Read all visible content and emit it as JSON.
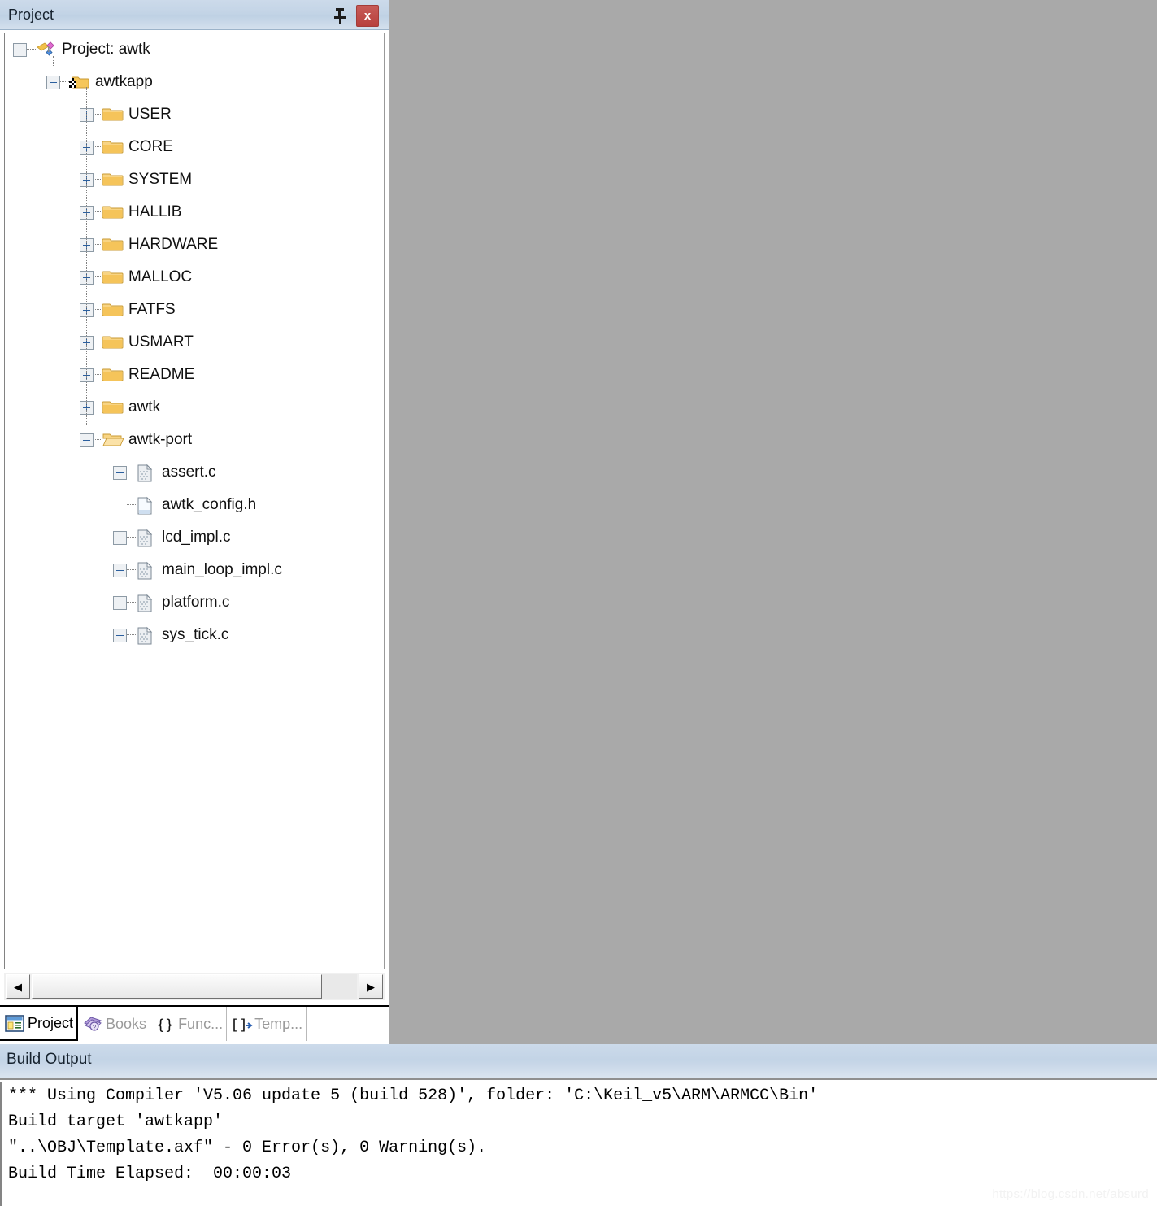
{
  "project_panel": {
    "title": "Project",
    "pin_icon": "pin-icon",
    "close_icon": "close-icon",
    "close_label": "x",
    "tree": [
      {
        "level": 0,
        "label": "Project: awtk",
        "icon": "project-icon",
        "expander": "minus"
      },
      {
        "level": 1,
        "label": "awtkapp",
        "icon": "target-folder-icon",
        "expander": "minus"
      },
      {
        "level": 2,
        "label": "USER",
        "icon": "folder-closed-icon",
        "expander": "plus"
      },
      {
        "level": 2,
        "label": "CORE",
        "icon": "folder-closed-icon",
        "expander": "plus"
      },
      {
        "level": 2,
        "label": "SYSTEM",
        "icon": "folder-closed-icon",
        "expander": "plus"
      },
      {
        "level": 2,
        "label": "HALLIB",
        "icon": "folder-closed-icon",
        "expander": "plus"
      },
      {
        "level": 2,
        "label": "HARDWARE",
        "icon": "folder-closed-icon",
        "expander": "plus"
      },
      {
        "level": 2,
        "label": "MALLOC",
        "icon": "folder-closed-icon",
        "expander": "plus"
      },
      {
        "level": 2,
        "label": "FATFS",
        "icon": "folder-closed-icon",
        "expander": "plus"
      },
      {
        "level": 2,
        "label": "USMART",
        "icon": "folder-closed-icon",
        "expander": "plus"
      },
      {
        "level": 2,
        "label": "README",
        "icon": "folder-closed-icon",
        "expander": "plus"
      },
      {
        "level": 2,
        "label": "awtk",
        "icon": "folder-closed-icon",
        "expander": "plus"
      },
      {
        "level": 2,
        "label": "awtk-port",
        "icon": "folder-open-icon",
        "expander": "minus"
      },
      {
        "level": 3,
        "label": "assert.c",
        "icon": "source-file-icon",
        "expander": "plus"
      },
      {
        "level": 3,
        "label": "awtk_config.h",
        "icon": "header-file-icon",
        "expander": "none"
      },
      {
        "level": 3,
        "label": "lcd_impl.c",
        "icon": "source-file-icon",
        "expander": "plus"
      },
      {
        "level": 3,
        "label": "main_loop_impl.c",
        "icon": "source-file-icon",
        "expander": "plus"
      },
      {
        "level": 3,
        "label": "platform.c",
        "icon": "source-file-icon",
        "expander": "plus"
      },
      {
        "level": 3,
        "label": "sys_tick.c",
        "icon": "source-file-icon",
        "expander": "plus"
      }
    ],
    "scrollbar": {
      "left_arrow": "◀",
      "right_arrow": "▶"
    },
    "tabs": [
      {
        "label": "Project",
        "icon": "project-window-icon",
        "active": true
      },
      {
        "label": "Books",
        "icon": "books-icon",
        "active": false
      },
      {
        "label": "Func...",
        "icon": "functions-icon",
        "active": false
      },
      {
        "label": "Temp...",
        "icon": "templates-icon",
        "active": false
      }
    ]
  },
  "build_output": {
    "title": "Build Output",
    "lines": [
      "*** Using Compiler 'V5.06 update 5 (build 528)', folder: 'C:\\Keil_v5\\ARM\\ARMCC\\Bin'",
      "Build target 'awtkapp'",
      "\"..\\OBJ\\Template.axf\" - 0 Error(s), 0 Warning(s).",
      "Build Time Elapsed:  00:00:03"
    ]
  },
  "watermark": {
    "text": "https://blog.csdn.net/absurd"
  },
  "colors": {
    "titlebar_gradient_top": "#ccdaea",
    "titlebar_gradient_bottom": "#d4e0ed",
    "close_button": "#b8403d",
    "editor_background": "#a9a9a9",
    "folder_yellow": "#f5c65a",
    "tree_background": "#ffffff"
  }
}
